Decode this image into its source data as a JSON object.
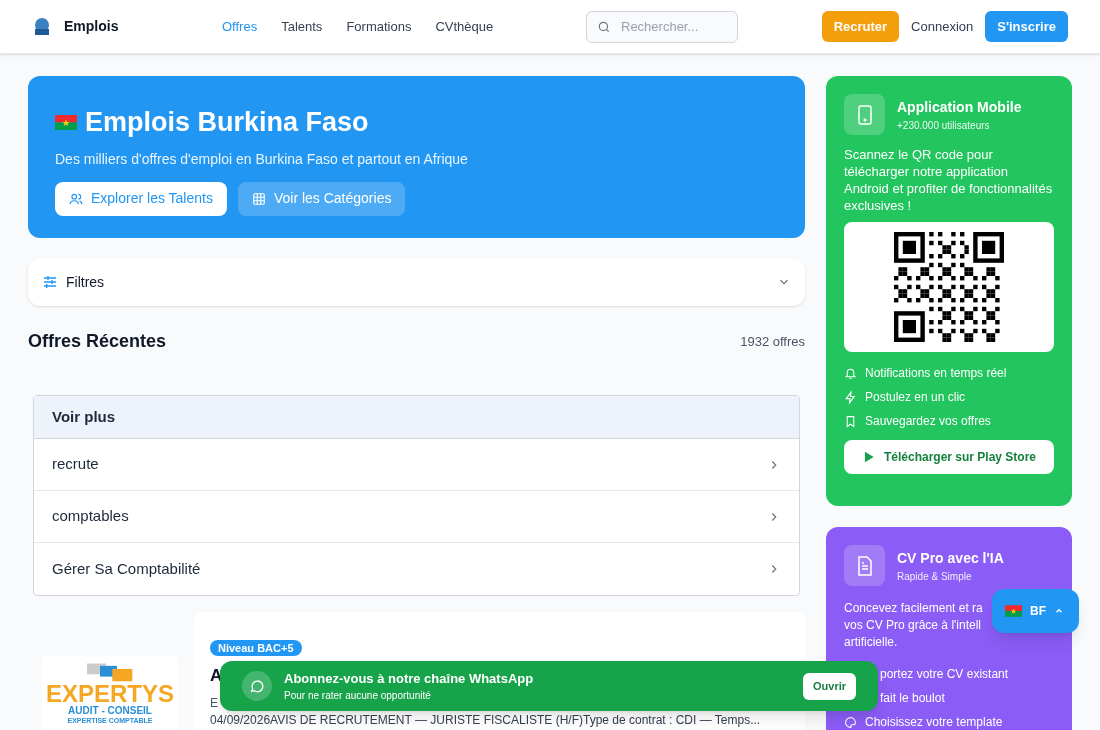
{
  "header": {
    "brand": "Emplois",
    "nav": [
      {
        "label": "Offres",
        "selected": true
      },
      {
        "label": "Talents",
        "selected": false
      },
      {
        "label": "Formations",
        "selected": false
      },
      {
        "label": "CVthèque",
        "selected": false
      }
    ],
    "search": {
      "placeholder": "Rechercher..."
    },
    "recruit": "Recruter",
    "login": "Connexion",
    "signup": "S'inscrire"
  },
  "hero": {
    "title": "Emplois Burkina Faso",
    "subtitle": "Des milliers d'offres d'emploi en Burkina Faso et partout en Afrique",
    "buttons": [
      {
        "label": "Explorer les Talents",
        "kind": "primary"
      },
      {
        "label": "Voir les Catégories",
        "kind": "secondary"
      }
    ]
  },
  "filters": {
    "label": "Filtres",
    "expanded": false
  },
  "section": {
    "title": "Offres Récentes",
    "count": "1932 offres"
  },
  "more_list": {
    "header": "Voir plus",
    "items": [
      "recrute",
      "comptables",
      "Gérer Sa Comptabilité"
    ]
  },
  "job": {
    "badge": "Niveau BAC+5",
    "title": "A",
    "meta": "E",
    "description": "04/09/2026AVIS DE RECRUTEMENT — JURISTE FISCALISTE (H/F)Type de contrat : CDI — Temps...",
    "logo": {
      "name": "EXPERTYS",
      "line1": "AUDIT - CONSEIL",
      "line2": "EXPERTISE COMPTABLE"
    }
  },
  "app_card": {
    "title": "Application Mobile",
    "subtitle": "+230.000 utilisateurs",
    "text": "Scannez le QR code pour télécharger notre application Android et profiter de fonctionnalités exclusives !",
    "features": [
      {
        "kind": "bell",
        "label": "Notifications en temps réel"
      },
      {
        "kind": "bolt",
        "label": "Postulez en un clic"
      },
      {
        "kind": "bookmark",
        "label": "Sauvegardez vos offres"
      }
    ],
    "button": "Télécharger sur Play Store"
  },
  "cv_card": {
    "title": "CV Pro avec l'IA",
    "subtitle": "Rapide & Simple",
    "text_lines": [
      "Concevez facilement et ra",
      "vos CV Pro grâce à l'intell",
      "artificielle."
    ],
    "features": [
      {
        "kind": "hidden",
        "label": "portez votre CV existant"
      },
      {
        "kind": "hidden",
        "label": "fait le boulot"
      },
      {
        "kind": "palette",
        "label": "Choisissez votre template"
      }
    ]
  },
  "whatsapp": {
    "title": "Abonnez-vous à notre chaîne WhatsApp",
    "subtitle": "Pour ne rater aucune opportunité",
    "button": "Ouvrir"
  },
  "country": {
    "code": "BF",
    "expanded": false
  }
}
